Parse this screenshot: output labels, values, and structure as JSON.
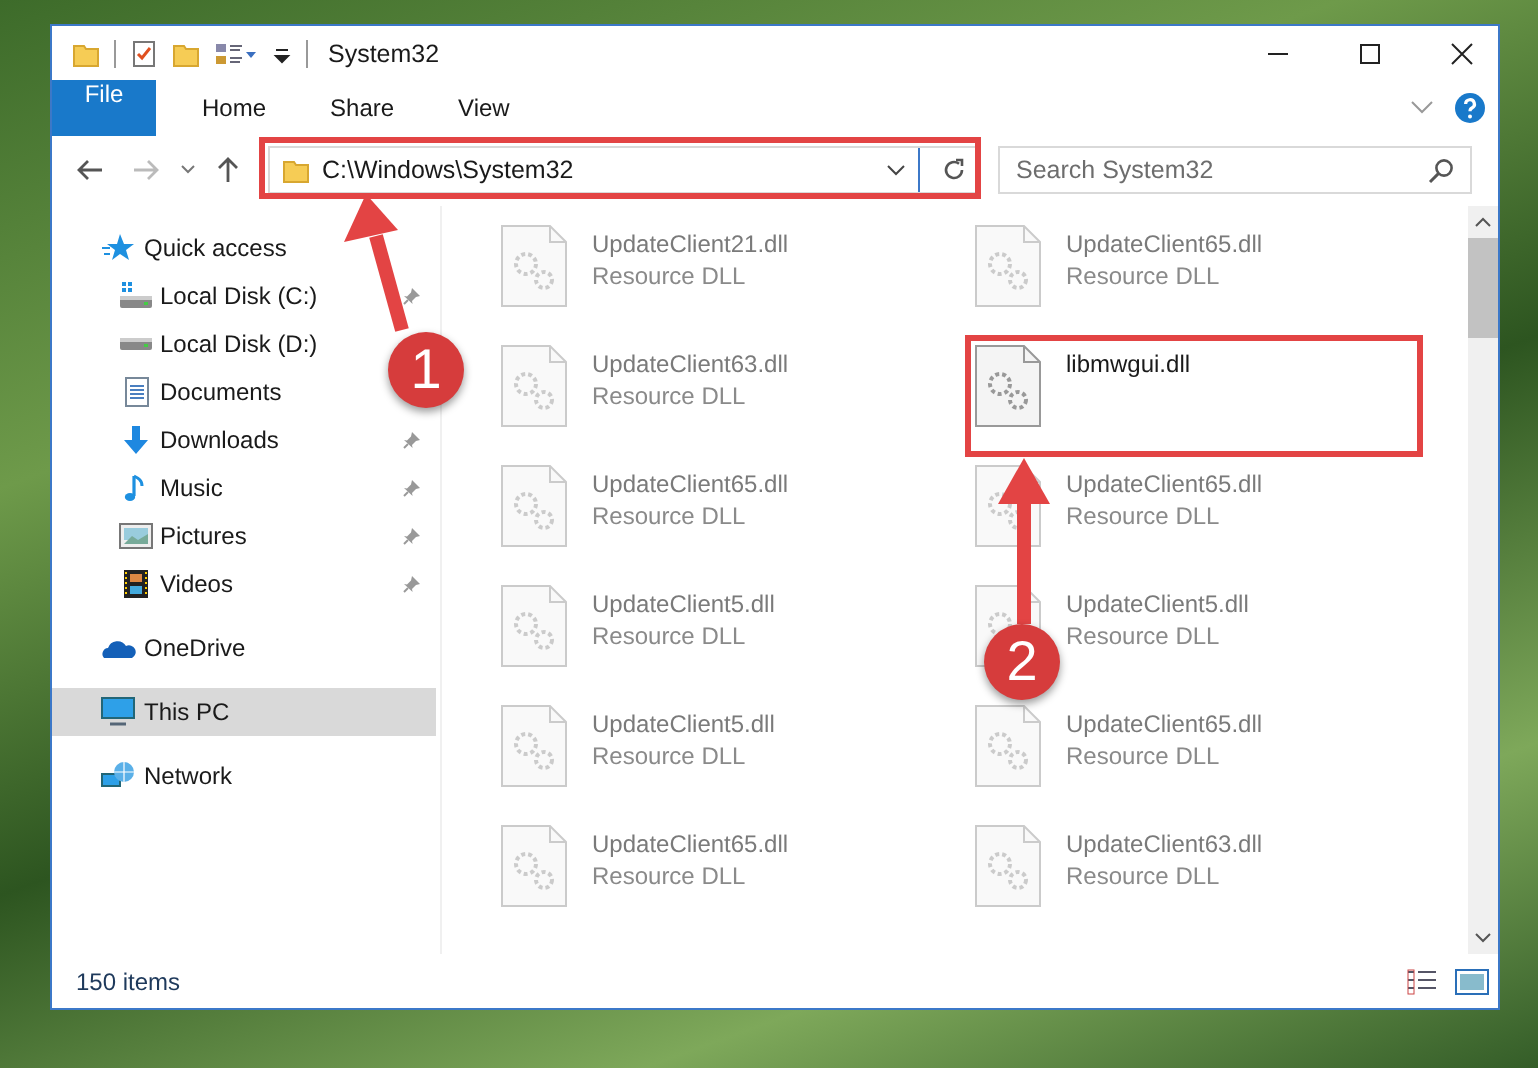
{
  "window": {
    "title": "System32"
  },
  "ribbon_tabs": [
    {
      "label": "File",
      "kind": "file"
    },
    {
      "label": "Home",
      "kind": "tab"
    },
    {
      "label": "Share",
      "kind": "tab"
    },
    {
      "label": "View",
      "kind": "tab"
    }
  ],
  "address_bar": {
    "path": "C:\\Windows\\System32"
  },
  "search": {
    "placeholder": "Search System32"
  },
  "navigation": [
    {
      "label": "Quick access",
      "kind": "star",
      "selected": false,
      "children": [
        {
          "label": "Local Disk (C:)",
          "kind": "systemdrive",
          "selected": false,
          "pinned": true
        },
        {
          "label": "Local Disk (D:)",
          "kind": "drive",
          "selected": false
        },
        {
          "label": "Documents",
          "kind": "documents",
          "selected": false
        },
        {
          "label": "Downloads",
          "kind": "downloads",
          "selected": false,
          "pinned": true
        },
        {
          "label": "Music",
          "kind": "music",
          "selected": false,
          "pinned": true
        },
        {
          "label": "Pictures",
          "kind": "pictures",
          "selected": false,
          "pinned": true
        },
        {
          "label": "Videos",
          "kind": "videos",
          "selected": false,
          "pinned": true
        }
      ]
    },
    {
      "label": "OneDrive",
      "kind": "cloud",
      "selected": false
    },
    {
      "label": "This PC",
      "kind": "pc",
      "selected": true
    },
    {
      "label": "Network",
      "kind": "network",
      "selected": false
    }
  ],
  "files": [
    {
      "name": "UpdateClient21.dll",
      "type": "Resource DLL",
      "blurred": true
    },
    {
      "name": "UpdateClient65.dll",
      "type": "Resource DLL",
      "blurred": true
    },
    {
      "name": "UpdateClient63.dll",
      "type": "Resource DLL",
      "blurred": true
    },
    {
      "name": "libmwgui.dll",
      "blurred": false
    },
    {
      "name": "UpdateClient65.dll",
      "type": "Resource DLL",
      "blurred": true
    },
    {
      "name": "UpdateClient65.dll",
      "type": "Resource DLL",
      "blurred": true
    },
    {
      "name": "UpdateClient5.dll",
      "type": "Resource DLL",
      "blurred": true
    },
    {
      "name": "UpdateClient5.dll",
      "type": "Resource DLL",
      "blurred": true
    },
    {
      "name": "UpdateClient5.dll",
      "type": "Resource DLL",
      "blurred": true
    },
    {
      "name": "UpdateClient65.dll",
      "type": "Resource DLL",
      "blurred": true
    },
    {
      "name": "UpdateClient65.dll",
      "type": "Resource DLL",
      "blurred": true
    },
    {
      "name": "UpdateClient63.dll",
      "type": "Resource DLL",
      "blurred": true
    }
  ],
  "status_bar": {
    "item_count": "150 items"
  },
  "annotations": [
    {
      "number": "1"
    },
    {
      "number": "2"
    }
  ]
}
